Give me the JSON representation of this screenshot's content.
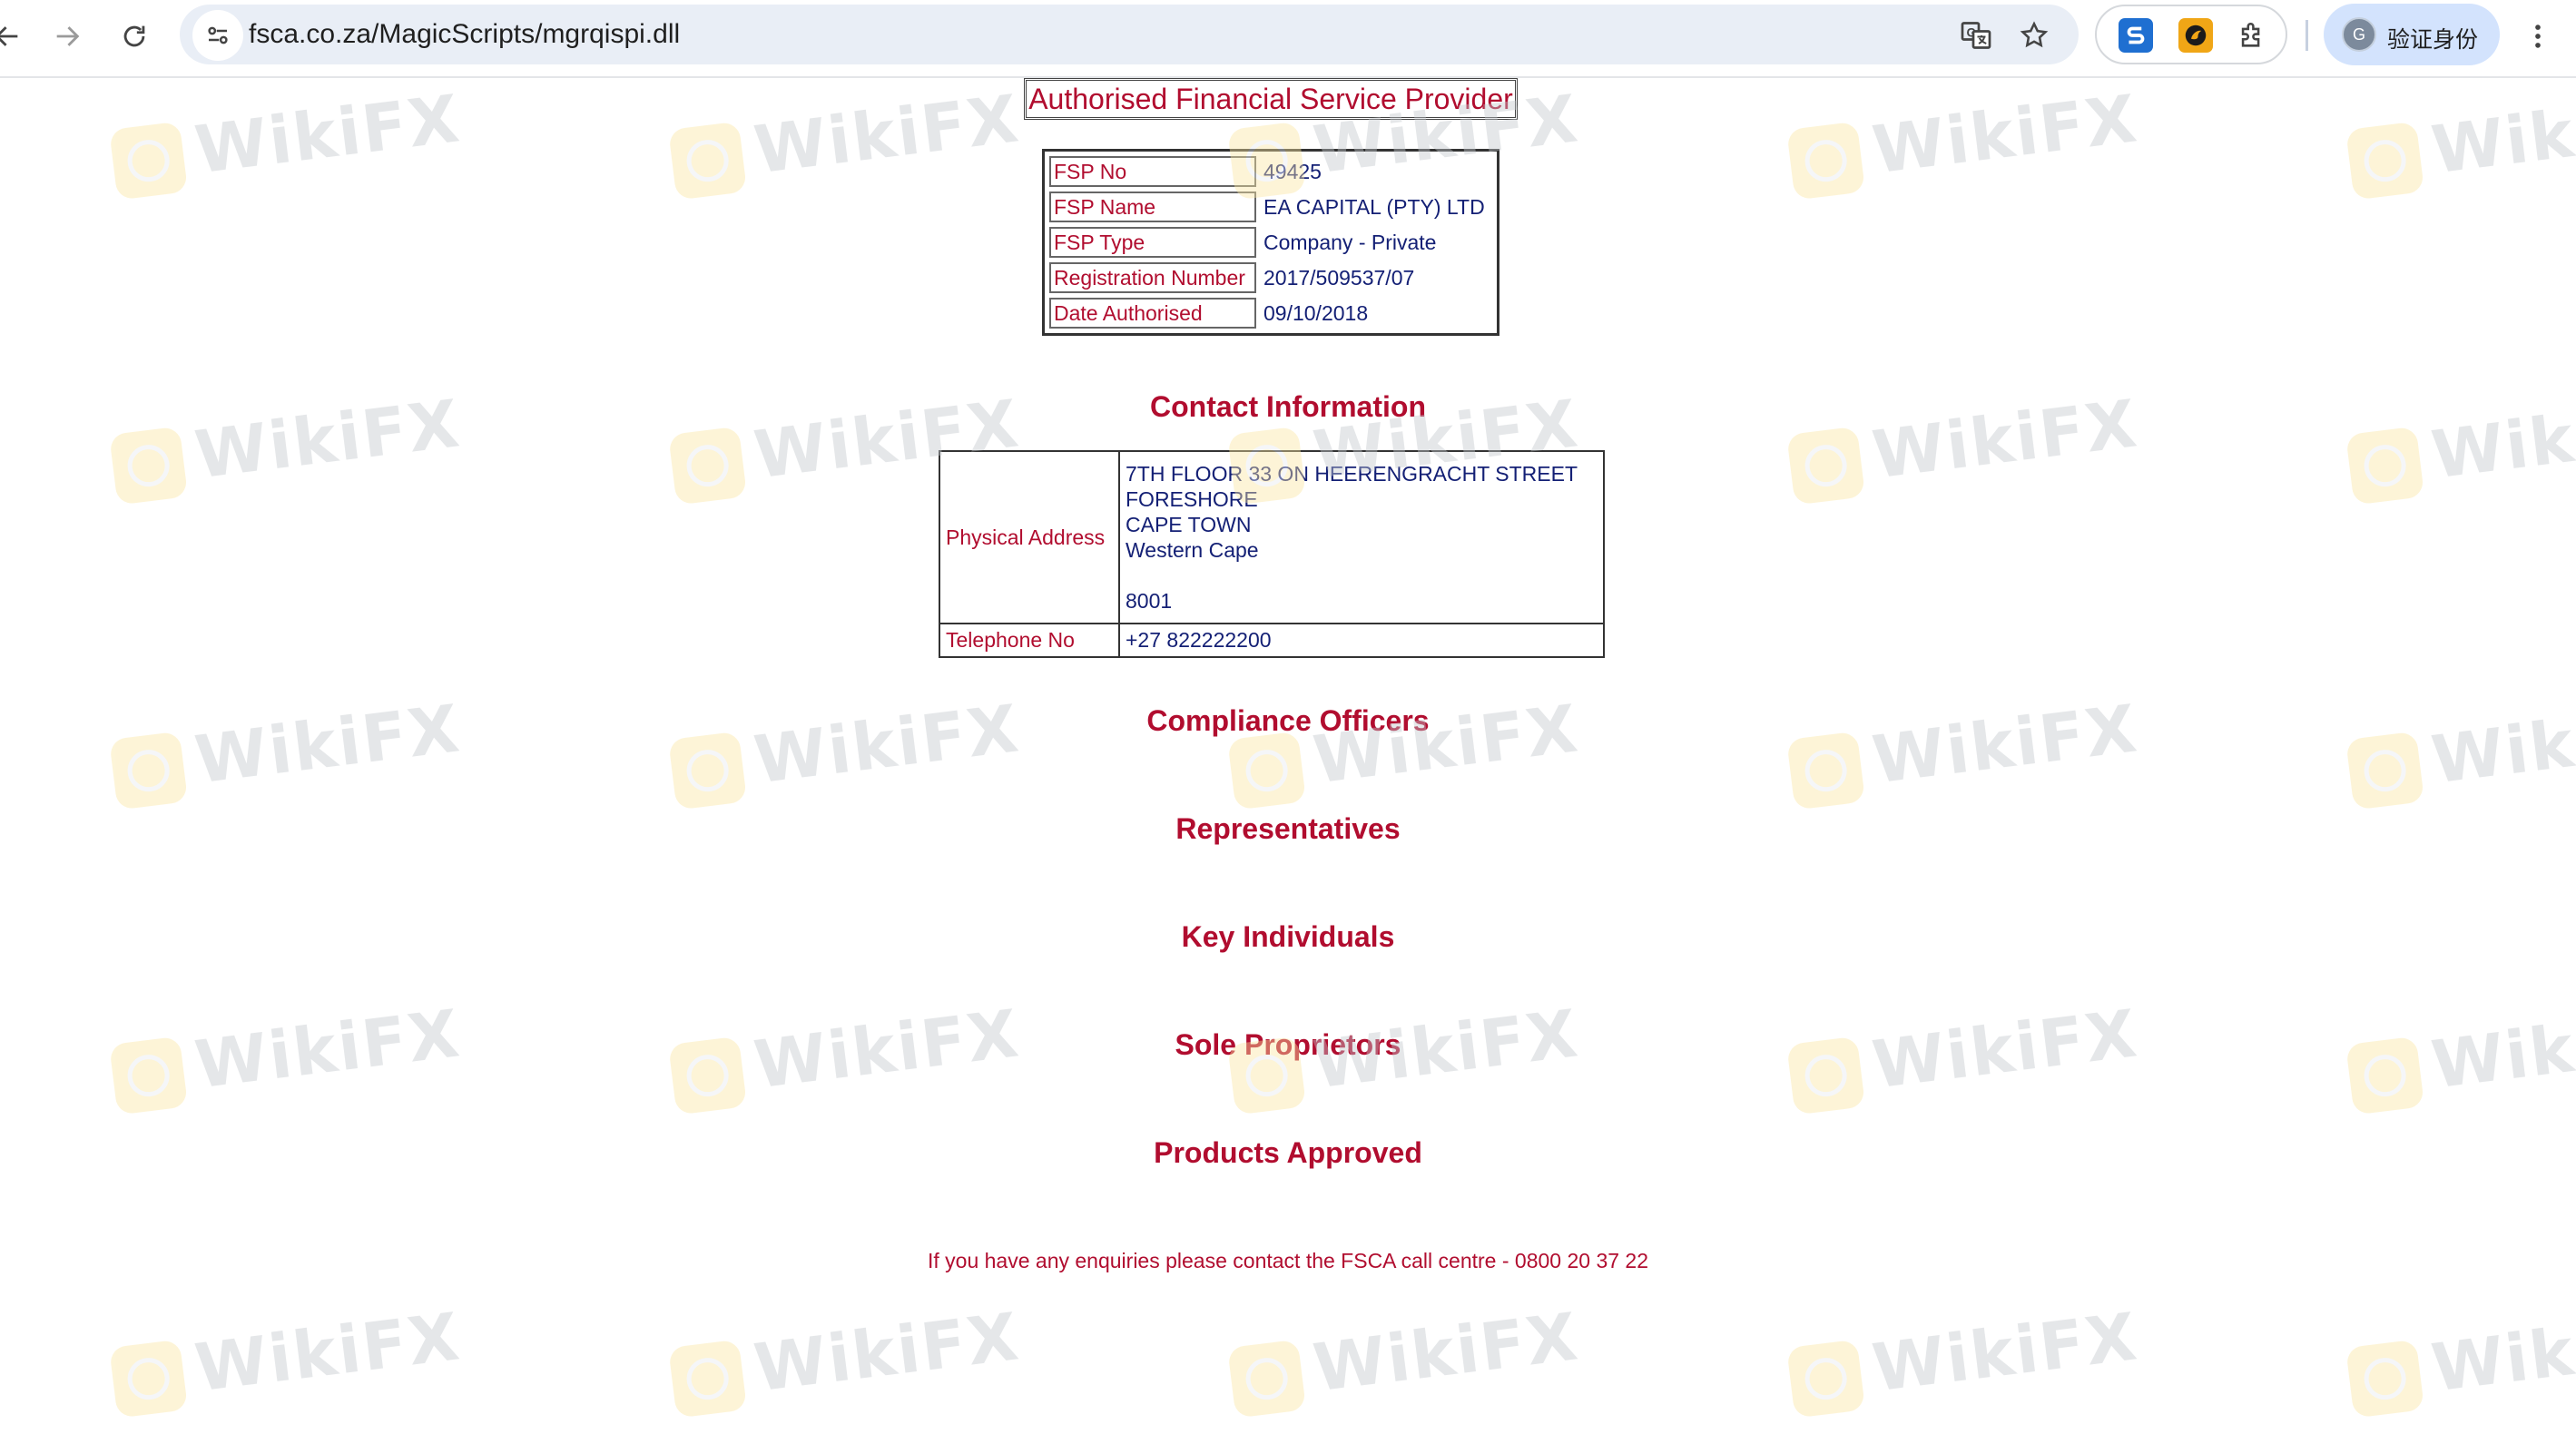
{
  "browser": {
    "url": "fsca.co.za/MagicScripts/mgrqispi.dll",
    "profile_label": "验证身份",
    "profile_initial": "G"
  },
  "page": {
    "title": "Authorised Financial Service Provider",
    "fsp_details": [
      {
        "label": "FSP No",
        "value": "49425"
      },
      {
        "label": "FSP Name",
        "value": "EA CAPITAL (PTY) LTD"
      },
      {
        "label": "FSP Type",
        "value": "Company - Private"
      },
      {
        "label": "Registration Number",
        "value": "2017/509537/07"
      },
      {
        "label": "Date Authorised",
        "value": "09/10/2018"
      }
    ],
    "contact_heading": "Contact Information",
    "contact": {
      "address_label": "Physical Address",
      "address_lines": [
        "7TH FLOOR 33 ON HEERENGRACHT STREET",
        "FORESHORE",
        "CAPE TOWN",
        "Western Cape",
        "",
        "8001"
      ],
      "telephone_label": "Telephone No",
      "telephone_value": "+27 822222200"
    },
    "sections": [
      "Compliance Officers",
      "Representatives",
      "Key Individuals",
      "Sole Proprietors",
      "Products Approved"
    ],
    "footer_note": "If you have any enquiries please contact the FSCA call centre - 0800 20 37 22"
  },
  "watermark": {
    "text": "WikiFX",
    "logo_color": "#fbe7a2",
    "text_color": "#c3c8cd"
  },
  "colors": {
    "label_red": "#b10d2f",
    "value_navy": "#142075"
  },
  "icons": [
    "back-arrow-icon",
    "forward-arrow-icon",
    "reload-icon",
    "site-info-icon",
    "translate-icon",
    "star-icon",
    "extension-s-icon",
    "extension-orange-icon",
    "puzzle-icon",
    "menu-icon"
  ]
}
